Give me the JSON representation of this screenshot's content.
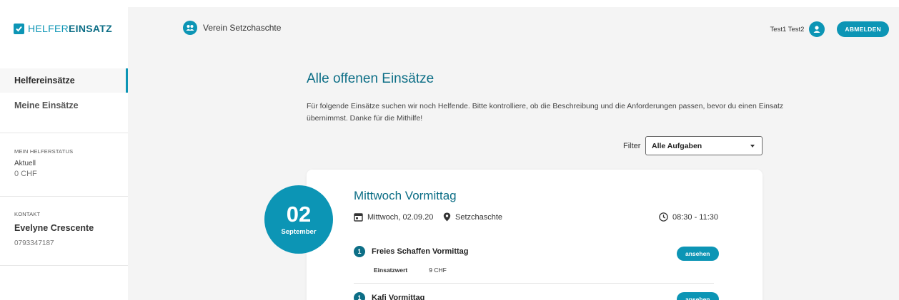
{
  "sidebar": {
    "logo_light": "HELFER",
    "logo_bold": "EINSATZ",
    "nav": [
      {
        "label": "Helfereinsätze"
      },
      {
        "label": "Meine Einsätze"
      }
    ],
    "status": {
      "heading": "MEIN HELFERSTATUS",
      "current_label": "Aktuell",
      "current_value": "0 CHF"
    },
    "contact": {
      "heading": "KONTAKT",
      "name": "Evelyne Crescente",
      "phone": "0793347187"
    }
  },
  "header": {
    "club_name": "Verein Setzchaschte",
    "user_name": "Test1 Test2",
    "logout_label": "ABMELDEN"
  },
  "main": {
    "title": "Alle offenen Einsätze",
    "intro": "Für folgende Einsätze suchen wir noch Helfende. Bitte kontrolliere, ob die Beschreibung und die Anforderungen passen, bevor du einen Einsatz übernimmst. Danke für die Mithilfe!",
    "filter_label": "Filter",
    "filter_value": "Alle Aufgaben"
  },
  "event": {
    "day": "02",
    "month": "September",
    "title": "Mittwoch Vormittag",
    "date": "Mittwoch, 02.09.20",
    "location": "Setzchaschte",
    "time": "08:30 - 11:30",
    "tasks": [
      {
        "num": "1",
        "name": "Freies Schaffen Vormittag",
        "value_label": "Einsatzwert",
        "value": "9 CHF",
        "button": "ansehen"
      },
      {
        "num": "1",
        "name": "Kafi Vormittag",
        "button": "ansehen"
      }
    ]
  },
  "colors": {
    "accent": "#0c95b5",
    "accent_dark": "#0c6e86",
    "background": "#f4f4f4"
  }
}
